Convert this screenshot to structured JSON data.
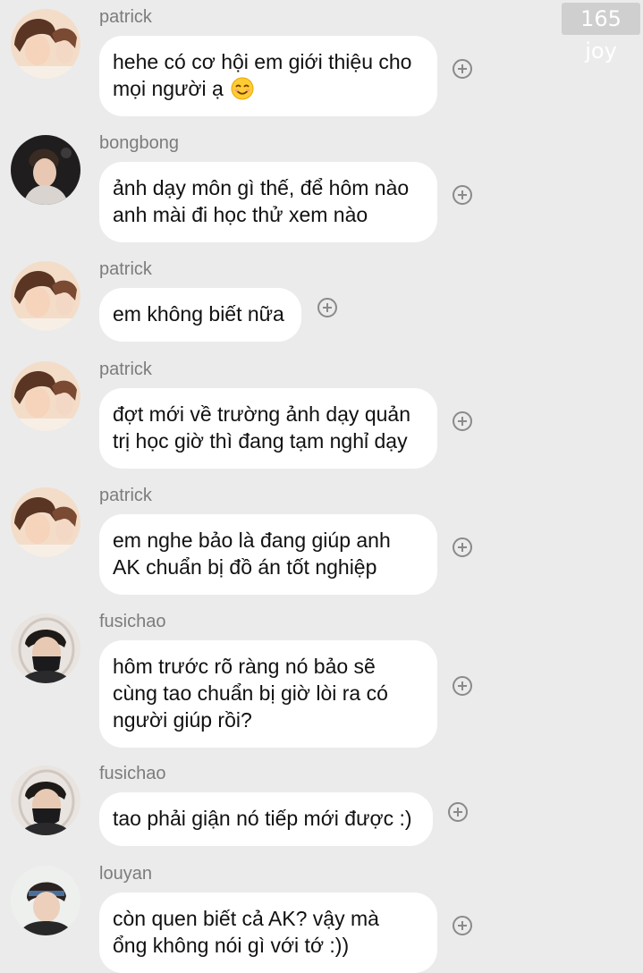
{
  "watermark": "165 joy",
  "colors": {
    "background": "#ebebeb",
    "bubble": "#ffffff",
    "username": "#7c7c7c",
    "text": "#111111",
    "add_icon": "#8a8a8a"
  },
  "messages": [
    {
      "username": "patrick",
      "avatar": "patrick-avatar",
      "lines": [
        "hehe có cơ hội em giới thiệu cho",
        "mọi người ạ"
      ],
      "emoji": "smiling-face-emoji"
    },
    {
      "username": "bongbong",
      "avatar": "bongbong-avatar",
      "lines": [
        "ảnh dạy môn gì thế, để hôm nào",
        "anh mài đi học thử xem nào"
      ]
    },
    {
      "username": "patrick",
      "avatar": "patrick-avatar",
      "lines": [
        "em không biết nữa"
      ]
    },
    {
      "username": "patrick",
      "avatar": "patrick-avatar",
      "lines": [
        "đợt mới về trường ảnh dạy quản",
        "trị học giờ thì đang tạm nghỉ dạy"
      ]
    },
    {
      "username": "patrick",
      "avatar": "patrick-avatar",
      "lines": [
        "em nghe bảo là đang giúp anh",
        "AK chuẩn bị đồ án tốt nghiệp"
      ]
    },
    {
      "username": "fusichao",
      "avatar": "fusichao-avatar",
      "lines": [
        "hôm trước rõ ràng nó bảo sẽ",
        "cùng tao chuẩn bị giờ lòi ra có",
        "người giúp rồi?"
      ]
    },
    {
      "username": "fusichao",
      "avatar": "fusichao-avatar",
      "lines": [
        "tao phải giận nó tiếp mới được :)"
      ]
    },
    {
      "username": "louyan",
      "avatar": "louyan-avatar",
      "lines": [
        "còn quen biết cả AK? vậy mà",
        "ổng không nói gì với tớ :))"
      ]
    }
  ]
}
